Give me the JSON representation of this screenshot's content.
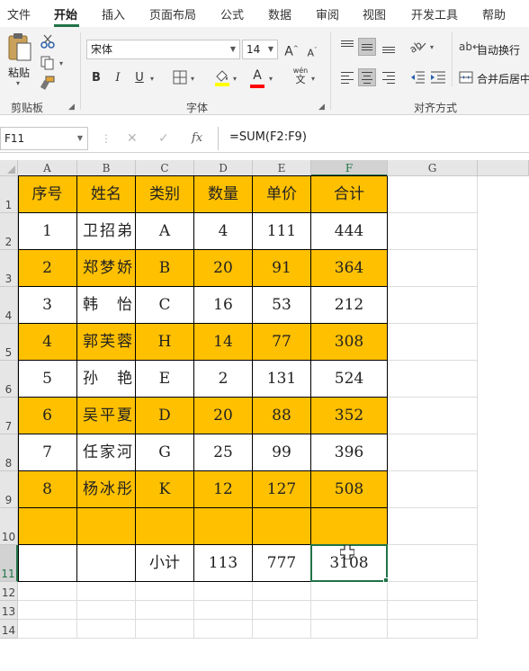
{
  "ribbon_tabs": [
    {
      "label": "文件",
      "active": false
    },
    {
      "label": "开始",
      "active": true
    },
    {
      "label": "插入",
      "active": false
    },
    {
      "label": "页面布局",
      "active": false
    },
    {
      "label": "公式",
      "active": false
    },
    {
      "label": "数据",
      "active": false
    },
    {
      "label": "审阅",
      "active": false
    },
    {
      "label": "视图",
      "active": false
    },
    {
      "label": "开发工具",
      "active": false
    },
    {
      "label": "帮助",
      "active": false
    }
  ],
  "clipboard": {
    "paste_label": "粘贴",
    "group_label": "剪贴板",
    "icons": [
      "paste-icon",
      "cut-icon",
      "copy-icon",
      "format-painter-icon"
    ]
  },
  "font": {
    "font_name": "宋体",
    "font_size": "14",
    "bold": "B",
    "italic": "I",
    "underline": "U",
    "grow": "A",
    "shrink": "A",
    "font_color_glyph": "A",
    "phonetic": "wén",
    "group_label": "字体",
    "colors": {
      "fill": "#ffff00",
      "font": "#ff0000"
    }
  },
  "alignment": {
    "wrap_text_label": "自动换行",
    "merge_label": "合并后居中",
    "group_label": "对齐方式"
  },
  "formula_bar": {
    "name_box": "F11",
    "fx": "fx",
    "formula": "=SUM(F2:F9)"
  },
  "sheet": {
    "columns": [
      "A",
      "B",
      "C",
      "D",
      "E",
      "F",
      "G"
    ],
    "selected_column": "F",
    "rows": [
      "1",
      "2",
      "3",
      "4",
      "5",
      "6",
      "7",
      "8",
      "9",
      "10",
      "11",
      "12",
      "13",
      "14"
    ],
    "selected_row": "11",
    "header": [
      "序号",
      "姓名",
      "类别",
      "数量",
      "单价",
      "合计"
    ],
    "data": [
      [
        "1",
        "卫招弟",
        "A",
        "4",
        "111",
        "444"
      ],
      [
        "2",
        "郑梦娇",
        "B",
        "20",
        "91",
        "364"
      ],
      [
        "3",
        "韩怡",
        "C",
        "16",
        "53",
        "212"
      ],
      [
        "4",
        "郭芙蓉",
        "H",
        "14",
        "77",
        "308"
      ],
      [
        "5",
        "孙艳",
        "E",
        "2",
        "131",
        "524"
      ],
      [
        "6",
        "吴平夏",
        "D",
        "20",
        "88",
        "352"
      ],
      [
        "7",
        "任家河",
        "G",
        "25",
        "99",
        "396"
      ],
      [
        "8",
        "杨冰彤",
        "K",
        "12",
        "127",
        "508"
      ]
    ],
    "blank_row": [
      "",
      "",
      "",
      "",
      "",
      ""
    ],
    "total_row": [
      "",
      "",
      "小计",
      "113",
      "777",
      "3108"
    ],
    "highlight_color": "#ffc000",
    "selection_color": "#217346"
  }
}
